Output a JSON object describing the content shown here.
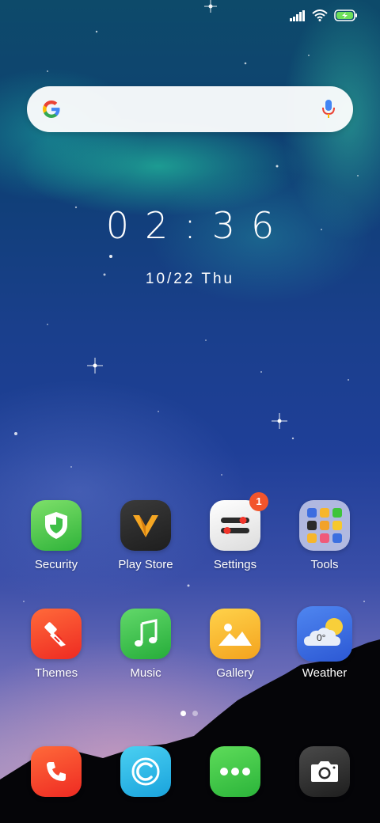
{
  "status_bar": {
    "signal_icon": "signal-icon",
    "wifi_icon": "wifi-icon",
    "battery_icon": "battery-charging-icon"
  },
  "search": {
    "logo_icon": "google-g-icon",
    "mic_icon": "microphone-icon"
  },
  "clock": {
    "time": "02:36",
    "date": "10/22 Thu"
  },
  "apps": {
    "security": {
      "label": "Security",
      "icon": "shield-icon",
      "color": "#3ec43a"
    },
    "play_store": {
      "label": "Play Store",
      "icon": "play-store-v-icon",
      "color": "#2b2b2b"
    },
    "settings": {
      "label": "Settings",
      "icon": "toggle-sliders-icon",
      "color": "#f2f2f2",
      "badge": "1"
    },
    "tools": {
      "label": "Tools",
      "icon": "folder-icon",
      "color": "#b9c0e0"
    },
    "themes": {
      "label": "Themes",
      "icon": "paintbrush-icon",
      "color": "#f2432a"
    },
    "music": {
      "label": "Music",
      "icon": "music-note-icon",
      "color": "#39c14a"
    },
    "gallery": {
      "label": "Gallery",
      "icon": "mountain-sun-icon",
      "color": "#f7b62c"
    },
    "weather": {
      "label": "Weather",
      "icon": "cloud-sun-icon",
      "color": "#3b6fe0",
      "temp": "0°"
    }
  },
  "page_indicator": {
    "pages": 2,
    "current": 1
  },
  "dock": {
    "phone": {
      "icon": "phone-icon",
      "color": "#f2432a"
    },
    "browser": {
      "icon": "browser-icon",
      "color": "#2bb8e6"
    },
    "messages": {
      "icon": "messages-dots-icon",
      "color": "#37c243"
    },
    "camera": {
      "icon": "camera-icon",
      "color": "#2a2a2a"
    }
  }
}
